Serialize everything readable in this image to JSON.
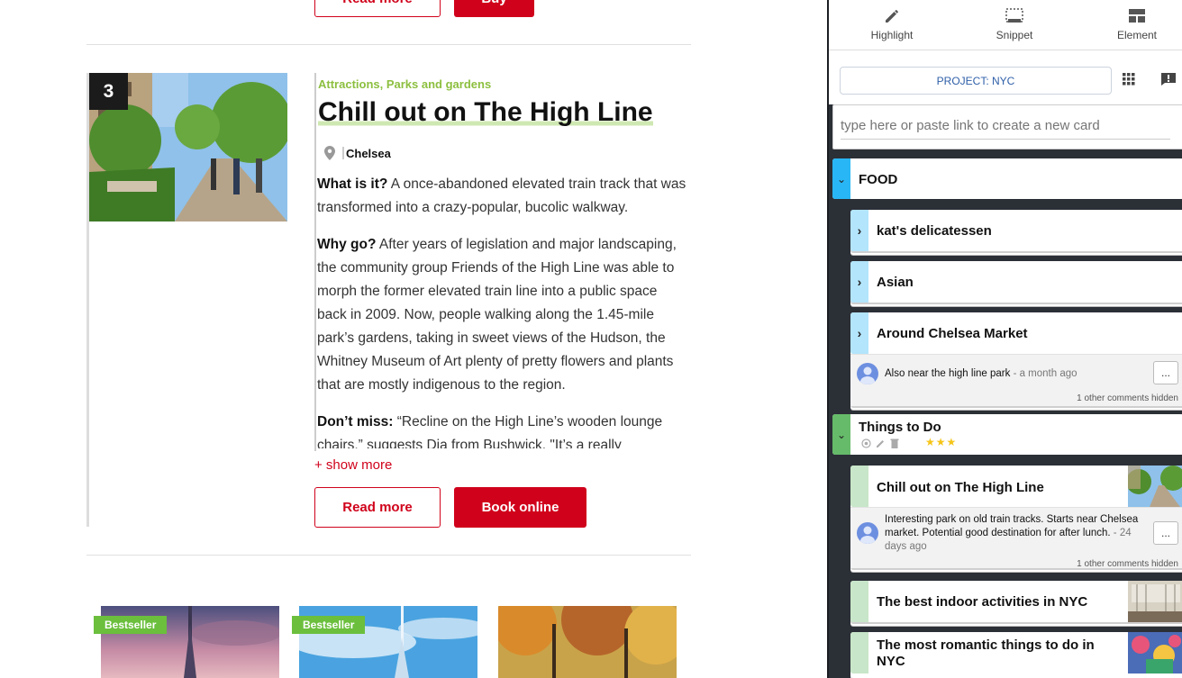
{
  "article": {
    "top_read_more": "Read more",
    "top_buy": "Buy",
    "rank": "3",
    "category": "Attractions, Parks and gardens",
    "title": "Chill out on The High Line",
    "location": "Chelsea",
    "what_label": "What is it?",
    "what_text": " A once-abandoned elevated train track that was transformed into a crazy-popular, bucolic walkway.",
    "why_label": "Why go?",
    "why_text": " After years of legislation and major landscaping, the community group Friends of the High Line was able to morph the former elevated train line into a public space back in 2009. Now, people walking along the 1.45-mile park’s gardens, taking in sweet views of the Hudson, the Whitney Museum of Art plenty of pretty flowers and plants that are mostly indigenous to the region.",
    "dont_label": "Don’t miss:",
    "dont_text": " “Recline on the High Line’s wooden lounge chairs,” suggests Dia from Bushwick. \"It’s a really",
    "show_more": "+ show more",
    "read_more": "Read more",
    "book_online": "Book online"
  },
  "bestsellers": [
    {
      "badge": "Bestseller"
    },
    {
      "badge": "Bestseller"
    }
  ],
  "panel": {
    "tools": [
      {
        "label": "Highlight",
        "icon": "pencil-icon"
      },
      {
        "label": "Snippet",
        "icon": "snippet-icon"
      },
      {
        "label": "Element",
        "icon": "element-icon"
      }
    ],
    "project": "PROJECT: NYC",
    "new_card_placeholder": "type here or paste link to create a new card",
    "groups": [
      {
        "name": "FOOD",
        "color": "#29b6f6"
      },
      {
        "name": "Things to Do",
        "color": "#66bb6a",
        "stars": "★★★"
      }
    ],
    "food_cards": [
      {
        "name": "kat's delicatessen"
      },
      {
        "name": "Asian"
      },
      {
        "name": "Around Chelsea Market"
      }
    ],
    "food_comment": {
      "text": "Also near the high line park",
      "ago": " - a month ago",
      "more": "...",
      "hidden": "1 other comments hidden"
    },
    "todo_cards": [
      {
        "name": "Chill out on The High Line"
      },
      {
        "name": "The best indoor activities in NYC"
      },
      {
        "name": "The most romantic things to do in NYC"
      }
    ],
    "todo_comment": {
      "text": "Interesting park on old train tracks. Starts near Chelsea market. Potential good destination for after lunch.",
      "ago": " - 24 days ago",
      "more": "...",
      "hidden": "1 other comments hidden"
    }
  },
  "colors": {
    "accent_red": "#d0021b",
    "category_green": "#8cbf3f",
    "food_blue": "#29b6f6",
    "todo_green": "#66bb6a",
    "card_tab_blue": "#b3e5fc",
    "card_tab_green": "#c8e6c9"
  }
}
